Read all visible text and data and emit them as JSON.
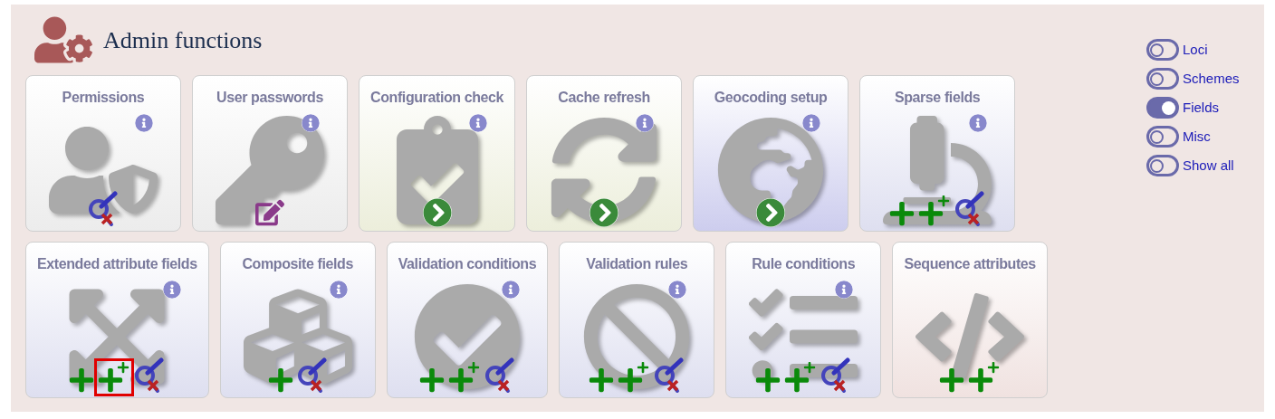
{
  "header": {
    "title": "Admin functions"
  },
  "rows": [
    [
      {
        "title": "Permissions",
        "color": "#ececec",
        "kind": "user-shield",
        "info": true,
        "actions": [
          {
            "kind": "query",
            "highlighted": false
          }
        ]
      },
      {
        "title": "User passwords",
        "color": "#ececec",
        "kind": "key",
        "info": true,
        "actions": [
          {
            "kind": "edit",
            "highlighted": false
          }
        ]
      },
      {
        "title": "Configuration check",
        "color": "#eceedb",
        "kind": "clipboard-check",
        "info": true,
        "actions": [
          {
            "kind": "go",
            "highlighted": false
          }
        ]
      },
      {
        "title": "Cache refresh",
        "color": "#eceedb",
        "kind": "sync",
        "info": true,
        "actions": [
          {
            "kind": "go",
            "highlighted": false
          }
        ]
      },
      {
        "title": "Geocoding setup",
        "color": "#cdcdee",
        "kind": "globe",
        "info": true,
        "actions": [
          {
            "kind": "go",
            "highlighted": false
          }
        ]
      },
      {
        "title": "Sparse fields",
        "color": "#dedff0",
        "kind": "microscope",
        "info": true,
        "actions": [
          {
            "kind": "add",
            "highlighted": false
          },
          {
            "kind": "batch-add",
            "highlighted": false
          },
          {
            "kind": "query",
            "highlighted": false
          }
        ]
      }
    ],
    [
      {
        "title": "Extended attribute fields",
        "color": "#dedff0",
        "kind": "expand",
        "info": true,
        "actions": [
          {
            "kind": "add",
            "highlighted": false
          },
          {
            "kind": "batch-add",
            "highlighted": true
          },
          {
            "kind": "query",
            "highlighted": false
          }
        ]
      },
      {
        "title": "Composite fields",
        "color": "#dedff0",
        "kind": "cubes",
        "info": true,
        "actions": [
          {
            "kind": "add",
            "highlighted": false
          },
          {
            "kind": "query",
            "highlighted": false
          }
        ]
      },
      {
        "title": "Validation conditions",
        "color": "#dedff0",
        "kind": "check-circle",
        "info": true,
        "actions": [
          {
            "kind": "add",
            "highlighted": false
          },
          {
            "kind": "batch-add",
            "highlighted": false
          },
          {
            "kind": "query",
            "highlighted": false
          }
        ]
      },
      {
        "title": "Validation rules",
        "color": "#dedff0",
        "kind": "ban",
        "info": true,
        "actions": [
          {
            "kind": "add",
            "highlighted": false
          },
          {
            "kind": "batch-add",
            "highlighted": false
          },
          {
            "kind": "query",
            "highlighted": false
          }
        ]
      },
      {
        "title": "Rule conditions",
        "color": "#dedff0",
        "kind": "tasks",
        "info": true,
        "actions": [
          {
            "kind": "add",
            "highlighted": false
          },
          {
            "kind": "batch-add",
            "highlighted": false
          },
          {
            "kind": "query",
            "highlighted": false
          }
        ]
      },
      {
        "title": "Sequence attributes",
        "color": "#f0e2e0",
        "kind": "code",
        "info": false,
        "actions": [
          {
            "kind": "add",
            "highlighted": false
          },
          {
            "kind": "batch-add",
            "highlighted": false
          }
        ]
      }
    ]
  ],
  "toggles": [
    {
      "label": "Loci",
      "on": false
    },
    {
      "label": "Schemes",
      "on": false
    },
    {
      "label": "Fields",
      "on": true
    },
    {
      "label": "Misc",
      "on": false
    },
    {
      "label": "Show all",
      "on": false
    }
  ]
}
